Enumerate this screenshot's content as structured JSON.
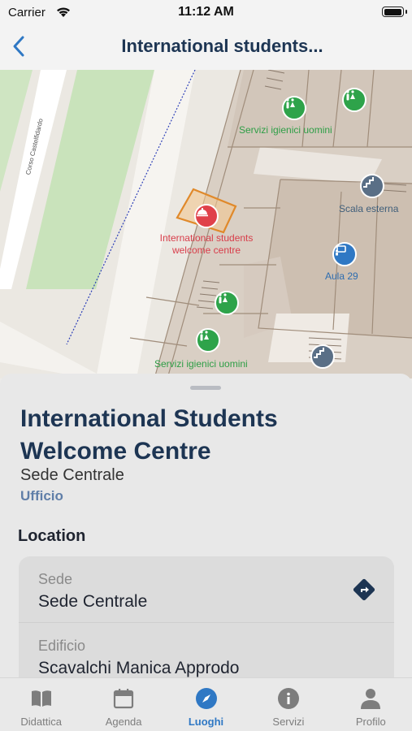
{
  "status_bar": {
    "carrier": "Carrier",
    "time": "11:12 AM"
  },
  "header": {
    "title": "International students..."
  },
  "map": {
    "road_label": "Corso Castelfidardo",
    "pois": [
      {
        "id": "toilets-1",
        "label": "Servizi igienici uomini",
        "icon": "toilet-icon",
        "color": "#2ea34a"
      },
      {
        "id": "stairs-1",
        "label": "Scala esterna",
        "icon": "stairs-icon",
        "color": "#5a6f86"
      },
      {
        "id": "welcome-centre",
        "label": "International students welcome centre",
        "icon": "reception-bell-icon",
        "color": "#e0414a"
      },
      {
        "id": "classroom",
        "label": "Aula 29",
        "icon": "classroom-icon",
        "color": "#2f78c4"
      },
      {
        "id": "toilets-2",
        "label": "Servizi igienici uomini",
        "icon": "toilet-icon",
        "color": "#2ea34a"
      }
    ],
    "welcome_label_lines": [
      "International students",
      "welcome centre"
    ]
  },
  "place": {
    "title": "International Students Welcome Centre",
    "campus": "Sede Centrale",
    "type": "Ufficio",
    "section_title": "Location",
    "details": [
      {
        "key": "Sede",
        "value": "Sede Centrale"
      },
      {
        "key": "Edificio",
        "value": "Scavalchi Manica Approdo"
      }
    ]
  },
  "tabbar": {
    "items": [
      {
        "label": "Didattica",
        "icon": "book-icon",
        "active": false
      },
      {
        "label": "Agenda",
        "icon": "calendar-icon",
        "active": false
      },
      {
        "label": "Luoghi",
        "icon": "compass-icon",
        "active": true
      },
      {
        "label": "Servizi",
        "icon": "info-icon",
        "active": false
      },
      {
        "label": "Profilo",
        "icon": "person-icon",
        "active": false
      }
    ]
  },
  "colors": {
    "accent": "#2f78c4",
    "title": "#1d3553",
    "type_label": "#5f7ea8"
  }
}
